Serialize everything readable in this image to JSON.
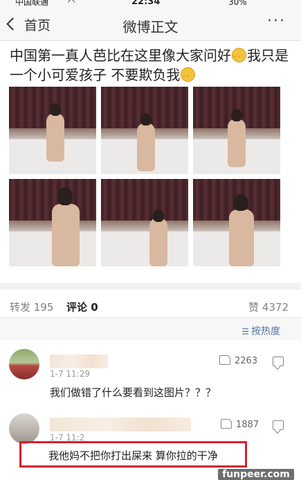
{
  "status_bar": {
    "carrier": "中国联通",
    "time": "22:34",
    "battery": "30%"
  },
  "nav": {
    "back_label": "首页",
    "title": "微博正文",
    "more_label": "···"
  },
  "post": {
    "text_part1": "中国第一真人芭比在这里像大家问好",
    "text_part2": "我只是一个小可爱孩子 不要欺负我",
    "emoji_icon": "cat-face-emoji"
  },
  "photos": [
    "photo-1",
    "photo-2",
    "photo-3",
    "photo-4",
    "photo-5",
    "photo-6"
  ],
  "stats": {
    "repost": "转发 195",
    "comments": "评论 0",
    "likes": "赞 4372"
  },
  "sort": {
    "label": "按热度",
    "icon": "sort-icon"
  },
  "comments": [
    {
      "time": "1-7 11:29",
      "likes": "2263",
      "text": "我们做错了什么要看到这图片？？？"
    },
    {
      "time": "1-7 11:2",
      "likes": "1887",
      "text": "我他妈不把你打出屎来 算你拉的干净"
    }
  ],
  "watermark": "funpeer.com",
  "colors": {
    "accent": "#f29b27",
    "link": "#5574a7",
    "highlight": "#d6202a"
  }
}
